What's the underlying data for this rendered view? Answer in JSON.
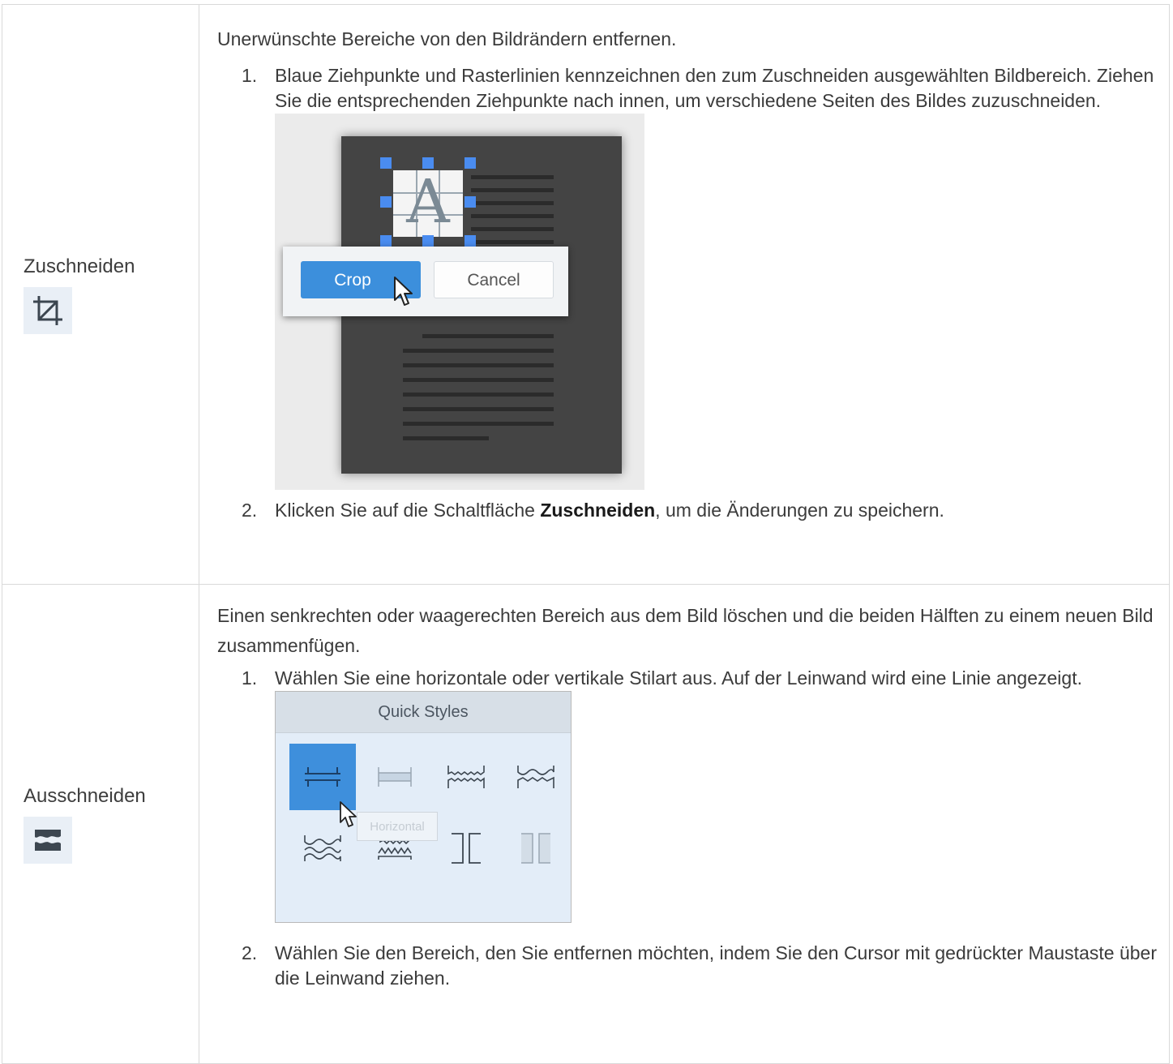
{
  "rows": [
    {
      "name": "Zuschneiden",
      "icon": "crop-icon",
      "intro": "Unerwünschte Bereiche von den Bildrändern entfernen.",
      "step1_num": "1.",
      "step1": "Blaue Ziehpunkte und Rasterlinien kennzeichnen den zum Zuschneiden ausgewählten Bildbereich. Ziehen Sie die entsprechenden Ziehpunkte nach innen, um verschiedene Seiten des Bildes zuzuschneiden.",
      "illustration": {
        "crop_label": "Crop",
        "cancel_label": "Cancel",
        "letter": "A"
      },
      "step2_num": "2.",
      "step2_before": "Klicken Sie auf die Schaltfläche ",
      "step2_bold": "Zuschneiden",
      "step2_after": ", um die Änderungen zu speichern."
    },
    {
      "name": "Ausschneiden",
      "icon": "cut-out-icon",
      "intro": "Einen senkrechten oder waagerechten Bereich aus dem Bild löschen und die beiden Hälften zu einem neuen Bild zusammenfügen.",
      "step1_num": "1.",
      "step1": "Wählen Sie eine horizontale oder vertikale Stilart aus. Auf der Leinwand wird eine Linie angezeigt.",
      "illustration": {
        "header": "Quick Styles",
        "tooltip": "Horizontal"
      },
      "step2_num": "2.",
      "step2": "Wählen Sie den Bereich, den Sie entfernen möchten, indem Sie den Cursor mit gedrückter Maustaste über die Leinwand ziehen."
    }
  ],
  "colors": {
    "accent_blue": "#3e8fdc",
    "handle_blue": "#4a8cf0",
    "border": "#d9d9d9"
  }
}
